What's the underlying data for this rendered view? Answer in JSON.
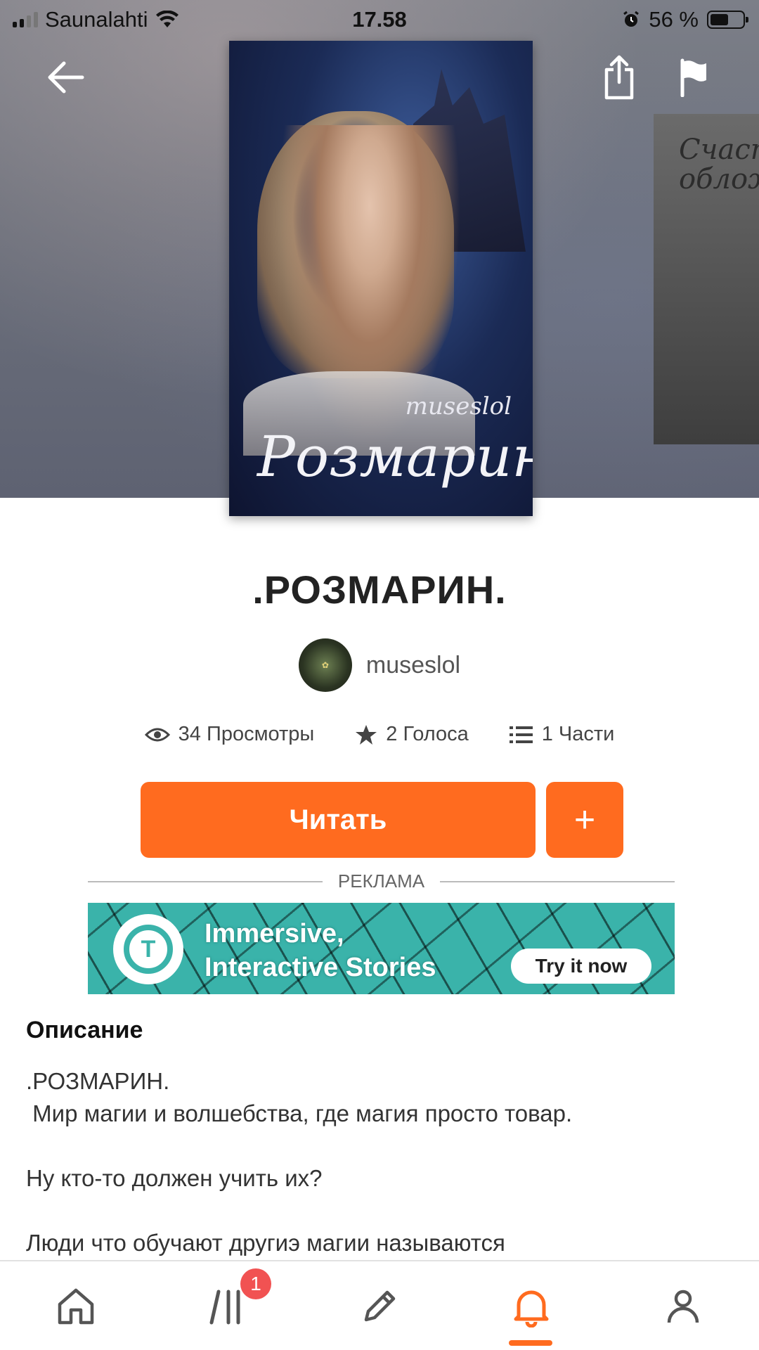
{
  "status_bar": {
    "carrier": "Saunalahti",
    "time": "17.58",
    "battery": "56 %"
  },
  "story": {
    "title": ".РОЗМАРИН.",
    "author": "museslol",
    "cover_author": "museslol",
    "cover_title": "Розмарин",
    "next_cover_text": "Счаст облож"
  },
  "stats": {
    "views": "34 Просмотры",
    "votes": "2 Голоса",
    "parts": "1 Части"
  },
  "actions": {
    "read_label": "Читать",
    "add_label": "+"
  },
  "ad": {
    "label": "РЕКЛАМА",
    "logo_letter": "T",
    "line1": "Immersive,",
    "line2": "Interactive Stories",
    "cta": "Try it now"
  },
  "description": {
    "heading": "Описание",
    "line1": ".РОЗМАРИН.",
    "line2": " Мир магии и волшебства, где магия просто товар.",
    "line3": "Ну кто-то должен учить их?",
    "line4": "Люди что обучают другиэ магии называются"
  },
  "nav": {
    "badge_count": "1",
    "active": "notifications"
  },
  "colors": {
    "accent": "#ff6b1f",
    "badge": "#f15252",
    "ad_bg": "#3ab3aa"
  }
}
